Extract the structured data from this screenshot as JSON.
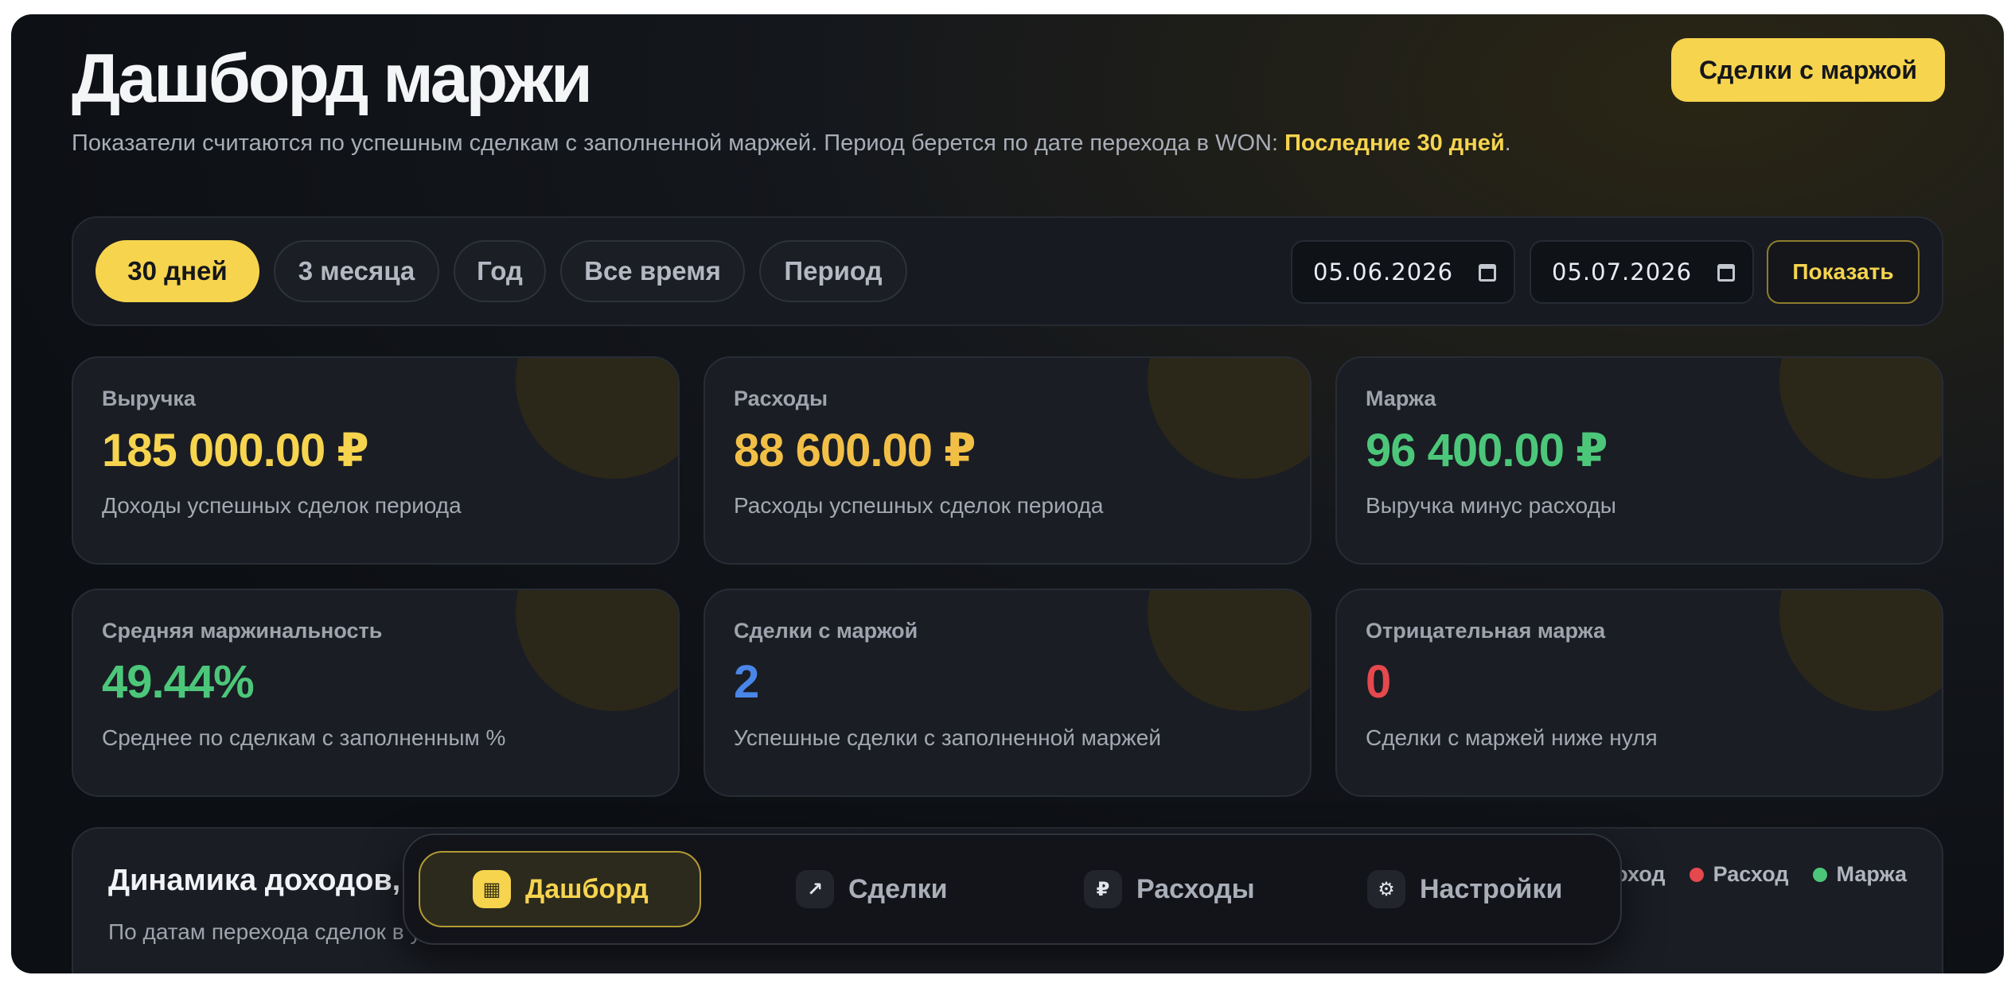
{
  "header": {
    "title": "Дашборд маржи",
    "subtitle_text": "Показатели считаются по успешным сделкам с заполненной маржей. Период берется по дате перехода в WON: ",
    "subtitle_highlight": "Последние 30 дней",
    "subtitle_end": ".",
    "deals_button": "Сделки с маржой"
  },
  "filters": {
    "chips": [
      "30 дней",
      "3 месяца",
      "Год",
      "Все время",
      "Период"
    ],
    "active_chip": "30 дней",
    "date_from": "05.06.2026",
    "date_to": "05.07.2026",
    "show_button": "Показать"
  },
  "cards": [
    {
      "label": "Выручка",
      "value": "185 000.00 ₽",
      "desc": "Доходы успешных сделок периода",
      "color": "#f6d44e"
    },
    {
      "label": "Расходы",
      "value": "88 600.00 ₽",
      "desc": "Расходы успешных сделок периода",
      "color": "#f2bf46"
    },
    {
      "label": "Маржа",
      "value": "96 400.00 ₽",
      "desc": "Выручка минус расходы",
      "color": "#4cc77a"
    },
    {
      "label": "Средняя маржинальность",
      "value": "49.44%",
      "desc": "Среднее по сделкам с заполненным %",
      "color": "#4cc77a"
    },
    {
      "label": "Сделки с маржой",
      "value": "2",
      "desc": "Успешные сделки с заполненной маржей",
      "color": "#4a86e8"
    },
    {
      "label": "Отрицательная маржа",
      "value": "0",
      "desc": "Сделки с маржей ниже нуля",
      "color": "#e5484d"
    }
  ],
  "chart_panel": {
    "title": "Динамика доходов,",
    "subtitle": "По датам перехода сделок в у",
    "legend": [
      {
        "name": "оход",
        "color": "#f6d44e"
      },
      {
        "name": "Расход",
        "color": "#e5484d"
      },
      {
        "name": "Маржа",
        "color": "#4cc77a"
      }
    ]
  },
  "nav": {
    "items": [
      {
        "label": "Дашборд",
        "icon": "dashboard-icon",
        "glyph": "▦"
      },
      {
        "label": "Сделки",
        "icon": "arrow-up-right-icon",
        "glyph": "↗"
      },
      {
        "label": "Расходы",
        "icon": "ruble-icon",
        "glyph": "₽"
      },
      {
        "label": "Настройки",
        "icon": "gear-icon",
        "glyph": "⚙"
      }
    ],
    "active": "Дашборд"
  }
}
